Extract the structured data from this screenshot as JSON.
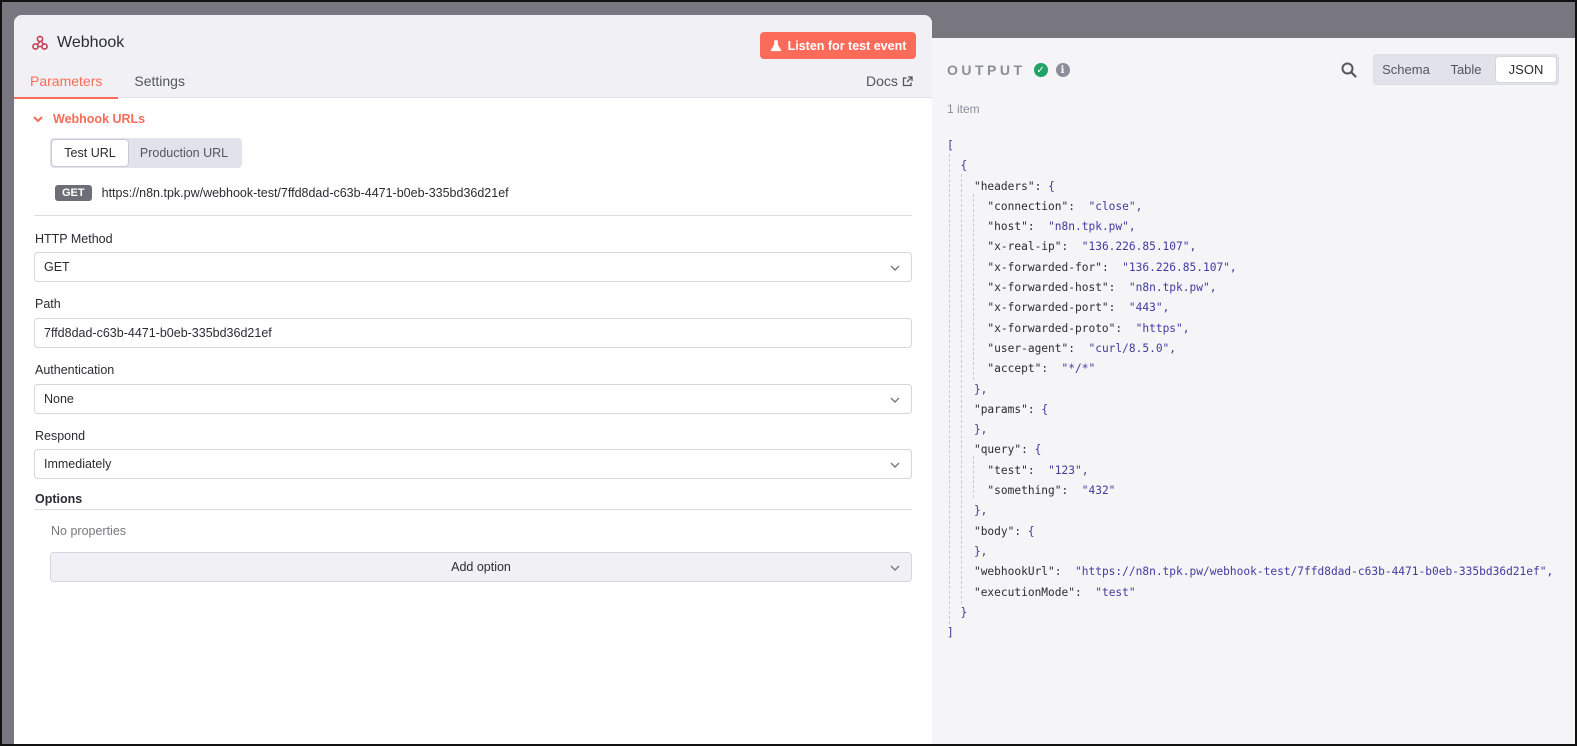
{
  "node": {
    "title": "Webhook"
  },
  "header": {
    "listen_label": "Listen for test event"
  },
  "tabs": [
    {
      "label": "Parameters"
    },
    {
      "label": "Settings"
    }
  ],
  "docs_label": "Docs",
  "webhook_urls": {
    "section_label": "Webhook URLs",
    "switch": [
      {
        "label": "Test URL"
      },
      {
        "label": "Production URL"
      }
    ],
    "method": "GET",
    "url": "https://n8n.tpk.pw/webhook-test/7ffd8dad-c63b-4471-b0eb-335bd36d21ef"
  },
  "fields": {
    "http_method": {
      "label": "HTTP Method",
      "value": "GET"
    },
    "path": {
      "label": "Path",
      "value": "7ffd8dad-c63b-4471-b0eb-335bd36d21ef"
    },
    "authentication": {
      "label": "Authentication",
      "value": "None"
    },
    "respond": {
      "label": "Respond",
      "value": "Immediately"
    }
  },
  "options": {
    "label": "Options",
    "empty_text": "No properties",
    "add_label": "Add option"
  },
  "output": {
    "title": "OUTPUT",
    "item_count": "1 item",
    "views": [
      {
        "label": "Schema"
      },
      {
        "label": "Table"
      },
      {
        "label": "JSON"
      }
    ],
    "json_lines": [
      {
        "text": "["
      },
      {
        "text": "  {"
      },
      {
        "text": "    \"headers\": {"
      },
      {
        "text": "      \"connection\":  \"close\","
      },
      {
        "text": "      \"host\":  \"n8n.tpk.pw\","
      },
      {
        "text": "      \"x-real-ip\":  \"136.226.85.107\","
      },
      {
        "text": "      \"x-forwarded-for\":  \"136.226.85.107\","
      },
      {
        "text": "      \"x-forwarded-host\":  \"n8n.tpk.pw\","
      },
      {
        "text": "      \"x-forwarded-port\":  \"443\","
      },
      {
        "text": "      \"x-forwarded-proto\":  \"https\","
      },
      {
        "text": "      \"user-agent\":  \"curl/8.5.0\","
      },
      {
        "text": "      \"accept\":  \"*/*\""
      },
      {
        "text": "    },"
      },
      {
        "text": "    \"params\": {"
      },
      {
        "text": "    },"
      },
      {
        "text": "    \"query\": {"
      },
      {
        "text": "      \"test\":  \"123\","
      },
      {
        "text": "      \"something\":  \"432\""
      },
      {
        "text": "    },"
      },
      {
        "text": "    \"body\": {"
      },
      {
        "text": "    },"
      },
      {
        "text": "    \"webhookUrl\":  \"https://n8n.tpk.pw/webhook-test/7ffd8dad-c63b-4471-b0eb-335bd36d21ef\","
      },
      {
        "text": "    \"executionMode\":  \"test\""
      },
      {
        "text": "  }"
      },
      {
        "text": "]"
      }
    ]
  },
  "colors": {
    "accent": "#fb6b59",
    "success": "#20a366",
    "json_value": "#403a9e"
  }
}
